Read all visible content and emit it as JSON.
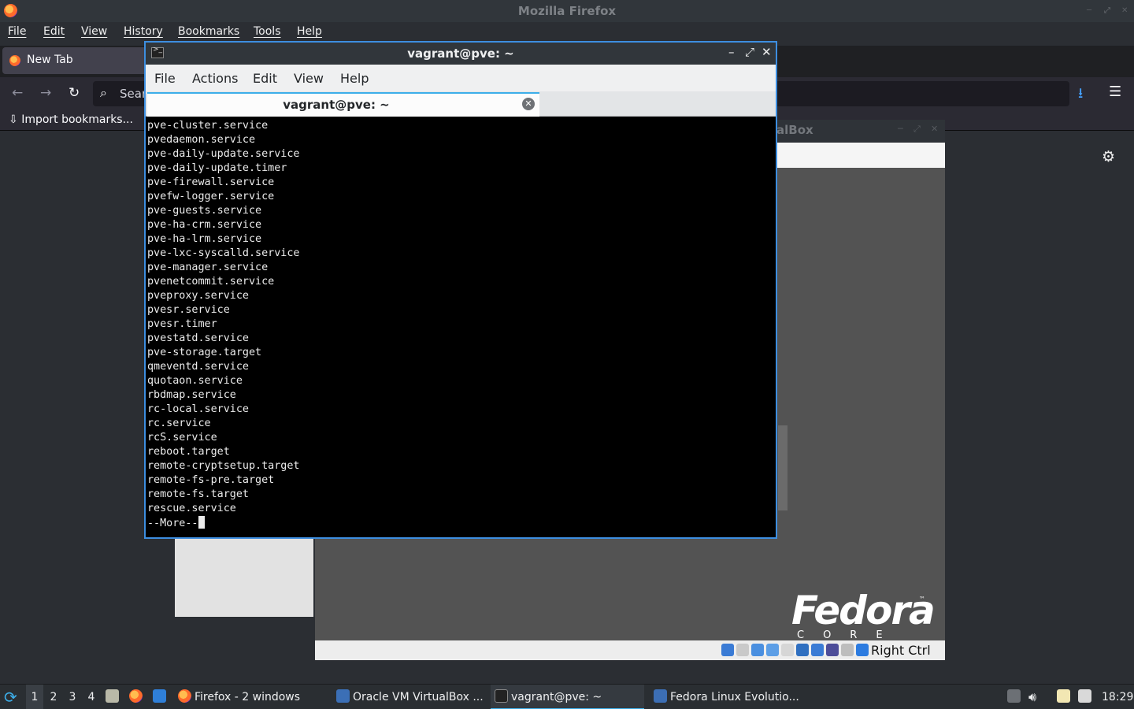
{
  "firefox": {
    "window_title": "Mozilla Firefox",
    "menu": [
      "File",
      "Edit",
      "View",
      "History",
      "Bookmarks",
      "Tools",
      "Help"
    ],
    "tab_label": "New Tab",
    "search_placeholder": "Sear",
    "bookmark_item": "Import bookmarks...",
    "icons": {
      "back": "back-arrow-icon",
      "forward": "forward-arrow-icon",
      "reload": "reload-icon",
      "search": "search-icon",
      "downloads": "download-icon",
      "menu": "hamburger-menu-icon",
      "settings": "gear-icon"
    }
  },
  "virtualbox": {
    "title_fragment": "alBox",
    "logo_text": "Fedora",
    "logo_sub": "CORE",
    "logo_tm": "™",
    "host_key": "Right Ctrl"
  },
  "terminal": {
    "window_title": "vagrant@pve: ~",
    "menu": [
      "File",
      "Actions",
      "Edit",
      "View",
      "Help"
    ],
    "tab_title": "vagrant@pve: ~",
    "lines": [
      "pve-cluster.service",
      "pvedaemon.service",
      "pve-daily-update.service",
      "pve-daily-update.timer",
      "pve-firewall.service",
      "pvefw-logger.service",
      "pve-guests.service",
      "pve-ha-crm.service",
      "pve-ha-lrm.service",
      "pve-lxc-syscalld.service",
      "pve-manager.service",
      "pvenetcommit.service",
      "pveproxy.service",
      "pvesr.service",
      "pvesr.timer",
      "pvestatd.service",
      "pve-storage.target",
      "qmeventd.service",
      "quotaon.service",
      "rbdmap.service",
      "rc-local.service",
      "rc.service",
      "rcS.service",
      "reboot.target",
      "remote-cryptsetup.target",
      "remote-fs-pre.target",
      "remote-fs.target",
      "rescue.service"
    ],
    "pager_prompt": "--More--"
  },
  "taskbar": {
    "workspaces": [
      "1",
      "2",
      "3",
      "4"
    ],
    "tasks": [
      "Firefox - 2 windows",
      "Oracle VM VirtualBox ...",
      "vagrant@pve: ~",
      "Fedora Linux Evolutio..."
    ],
    "clock": "18:29"
  }
}
